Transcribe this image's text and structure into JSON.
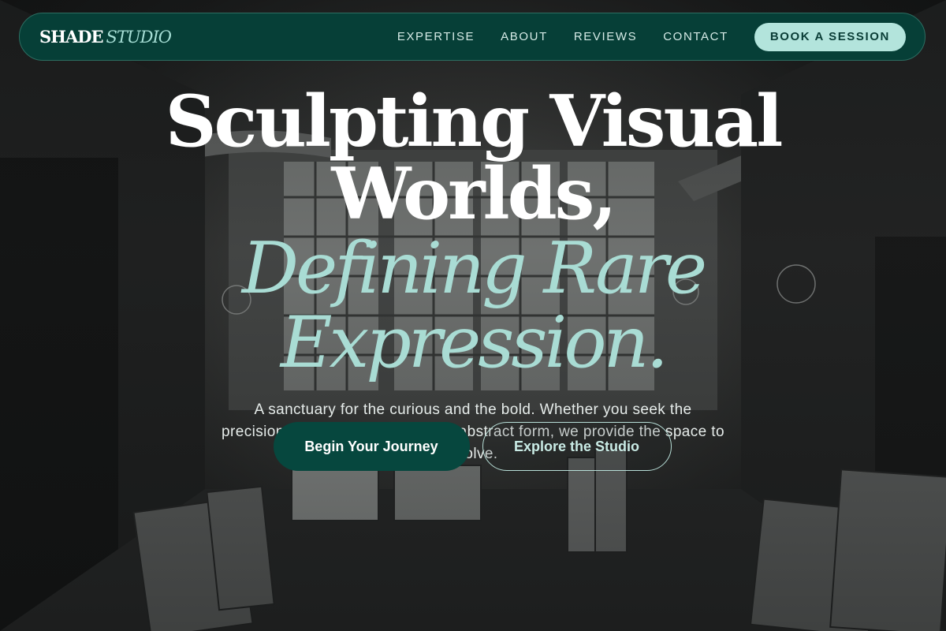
{
  "nav": {
    "logo_primary": "SHADE",
    "logo_secondary": "STUDIO",
    "links": [
      "EXPERTISE",
      "ABOUT",
      "REVIEWS",
      "CONTACT"
    ],
    "cta_label": "BOOK A SESSION"
  },
  "hero": {
    "headline_line1": "Sculpting Visual",
    "headline_line2": "Worlds,",
    "accent_line1": "Defining Rare",
    "accent_line2": "Expression.",
    "subtitle": "A sanctuary for the curious and the bold. Whether you seek the precision of oils or the freedom of abstract form, we provide the space to evolve.",
    "primary_button": "Begin Your Journey",
    "secondary_button": "Explore the Studio"
  },
  "colors": {
    "nav_bg": "#063f37",
    "accent_text": "#a9dcd4",
    "cta_bg": "#b3e4dc",
    "primary_button_bg": "#06473e"
  }
}
